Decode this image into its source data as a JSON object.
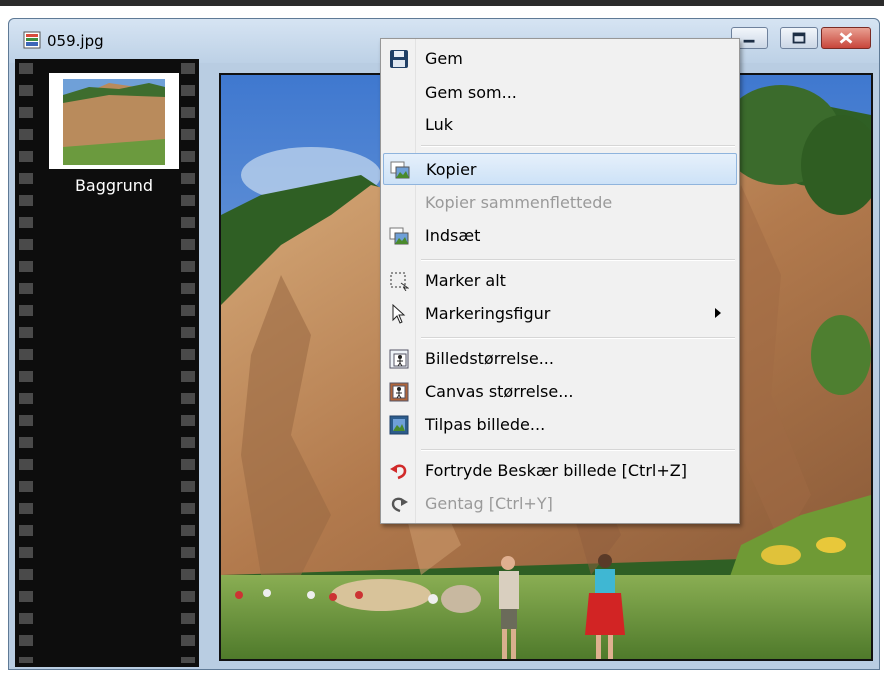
{
  "window": {
    "title": "059.jpg"
  },
  "layers": {
    "items": [
      {
        "label": "Baggrund"
      }
    ]
  },
  "context_menu": {
    "save": "Gem",
    "save_as": "Gem som...",
    "close": "Luk",
    "copy": "Kopier",
    "copy_merged": "Kopier sammenflettede",
    "paste": "Indsæt",
    "select_all": "Marker alt",
    "selection_shape": "Markeringsfigur",
    "image_size": "Billedstørrelse...",
    "canvas_size": "Canvas størrelse...",
    "fit_image": "Tilpas billede...",
    "undo": "Fortryde Beskær billede [Ctrl+Z]",
    "redo": "Gentag [Ctrl+Y]"
  },
  "colors": {
    "titlebar": "#bdd1e6",
    "filmstrip": "#0d0d0d",
    "menu_background": "#f1f1f1",
    "menu_highlight": "#cde2f7",
    "close_button": "#c8463b"
  }
}
